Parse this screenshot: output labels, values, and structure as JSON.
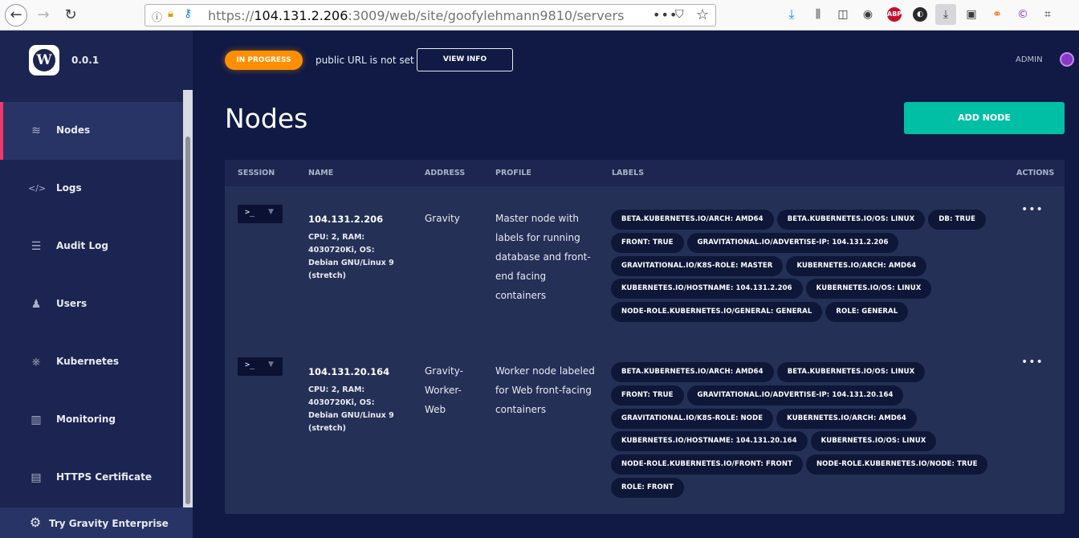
{
  "browser": {
    "url_prefix": "https://",
    "url_host": "104.131.2.206",
    "url_rest": ":3009/web/site/goofylehmann9810/servers",
    "icons": [
      "back-icon",
      "forward-icon",
      "reload-icon",
      "info-icon",
      "lock-icon",
      "key-icon",
      "more-icon",
      "pocket-icon",
      "bookmark-star-icon",
      "download-icon",
      "library-icon",
      "sidebar-icon",
      "account-icon",
      "adblock-icon",
      "extension-icon",
      "downloads-active-icon",
      "screenshot-icon",
      "link-icon",
      "copyright-icon",
      "crop-icon"
    ]
  },
  "sidebar": {
    "version": "0.0.1",
    "logo_letter": "W",
    "items": [
      {
        "label": "Nodes",
        "icon": "layers-icon",
        "glyph": "≋",
        "active": true
      },
      {
        "label": "Logs",
        "icon": "code-icon",
        "glyph": "</>",
        "active": false
      },
      {
        "label": "Audit Log",
        "icon": "list-icon",
        "glyph": "☰",
        "active": false
      },
      {
        "label": "Users",
        "icon": "users-icon",
        "glyph": "♟",
        "active": false
      },
      {
        "label": "Kubernetes",
        "icon": "helm-icon",
        "glyph": "⎈",
        "active": false
      },
      {
        "label": "Monitoring",
        "icon": "chart-icon",
        "glyph": "▥",
        "active": false
      },
      {
        "label": "HTTPS Certificate",
        "icon": "certificate-icon",
        "glyph": "▤",
        "active": false
      }
    ],
    "try_label": "Try Gravity Enterprise",
    "try_icon": "gear-icon"
  },
  "header": {
    "status": "IN PROGRESS",
    "status_color": "#ff8f00",
    "public_url": "public URL is not set",
    "view_info": "VIEW INFO",
    "user": "ADMIN"
  },
  "page": {
    "title": "Nodes",
    "add_node": "ADD NODE",
    "accent": "#00bfa5"
  },
  "table": {
    "columns": [
      "SESSION",
      "NAME",
      "ADDRESS",
      "PROFILE",
      "LABELS",
      "ACTIONS"
    ],
    "rows": [
      {
        "session_prompt": ">_",
        "name": "104.131.2.206",
        "spec": "CPU: 2, RAM: 4030720Ki, OS: Debian GNU/Linux 9 (stretch)",
        "address": "Gravity",
        "profile": "Master node with labels for running database and front-end facing containers",
        "labels": [
          [
            "BETA.KUBERNETES.IO/ARCH: AMD64",
            "BETA.KUBERNETES.IO/OS: LINUX",
            "DB: TRUE"
          ],
          [
            "FRONT: TRUE",
            "GRAVITATIONAL.IO/ADVERTISE-IP: 104.131.2.206"
          ],
          [
            "GRAVITATIONAL.IO/K8S-ROLE: MASTER",
            "KUBERNETES.IO/ARCH: AMD64"
          ],
          [
            "KUBERNETES.IO/HOSTNAME: 104.131.2.206",
            "KUBERNETES.IO/OS: LINUX"
          ],
          [
            "NODE-ROLE.KUBERNETES.IO/GENERAL: GENERAL",
            "ROLE: GENERAL"
          ]
        ],
        "actions": "•••"
      },
      {
        "session_prompt": ">_",
        "name": "104.131.20.164",
        "spec": "CPU: 2, RAM: 4030720Ki, OS: Debian GNU/Linux 9 (stretch)",
        "address": "Gravity-Worker-Web",
        "profile": "Worker node labeled for Web front-facing containers",
        "labels": [
          [
            "BETA.KUBERNETES.IO/ARCH: AMD64",
            "BETA.KUBERNETES.IO/OS: LINUX"
          ],
          [
            "FRONT: TRUE",
            "GRAVITATIONAL.IO/ADVERTISE-IP: 104.131.20.164"
          ],
          [
            "GRAVITATIONAL.IO/K8S-ROLE: NODE",
            "KUBERNETES.IO/ARCH: AMD64"
          ],
          [
            "KUBERNETES.IO/HOSTNAME: 104.131.20.164",
            "KUBERNETES.IO/OS: LINUX"
          ],
          [
            "NODE-ROLE.KUBERNETES.IO/FRONT: FRONT",
            "NODE-ROLE.KUBERNETES.IO/NODE: TRUE"
          ],
          [
            "ROLE: FRONT"
          ]
        ],
        "actions": "•••"
      }
    ]
  }
}
